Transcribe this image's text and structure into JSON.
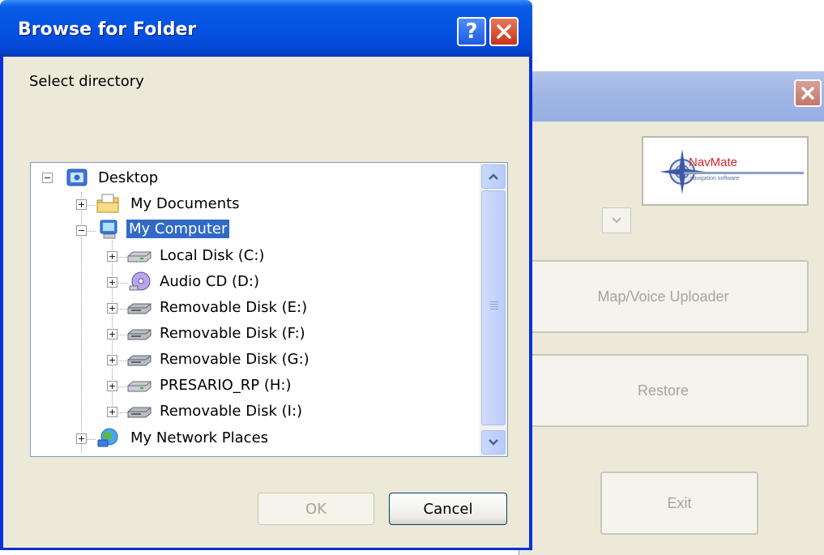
{
  "background_window": {
    "logo": {
      "brand": "NavMate",
      "tagline": "navigation software"
    },
    "map_voice_button": "Map/Voice Uploader",
    "restore_button": "Restore",
    "exit_button": "Exit"
  },
  "dialog": {
    "title": "Browse for Folder",
    "prompt": "Select directory",
    "tree": {
      "items": [
        {
          "label": "Desktop",
          "icon": "desktop-icon",
          "expanded": true
        },
        {
          "label": "My Documents",
          "icon": "folder-documents-icon",
          "expanded": false
        },
        {
          "label": "My Computer",
          "icon": "computer-icon",
          "expanded": true,
          "selected": true
        },
        {
          "label": "Local Disk (C:)",
          "icon": "hard-disk-icon",
          "expanded": false
        },
        {
          "label": "Audio CD (D:)",
          "icon": "cd-drive-icon",
          "expanded": false
        },
        {
          "label": "Removable Disk (E:)",
          "icon": "removable-disk-icon",
          "expanded": false
        },
        {
          "label": "Removable Disk (F:)",
          "icon": "removable-disk-icon",
          "expanded": false
        },
        {
          "label": "Removable Disk (G:)",
          "icon": "removable-disk-icon",
          "expanded": false
        },
        {
          "label": "PRESARIO_RP (H:)",
          "icon": "hard-disk-icon",
          "expanded": false
        },
        {
          "label": "Removable Disk (I:)",
          "icon": "removable-disk-icon",
          "expanded": false
        },
        {
          "label": "My Network Places",
          "icon": "network-places-icon",
          "expanded": false
        }
      ]
    },
    "ok_button": "OK",
    "cancel_button": "Cancel"
  },
  "colors": {
    "titlebar": "#0554e3",
    "selection": "#316ac5",
    "dialog_face": "#ece9d8",
    "close_button": "#c4341a"
  }
}
